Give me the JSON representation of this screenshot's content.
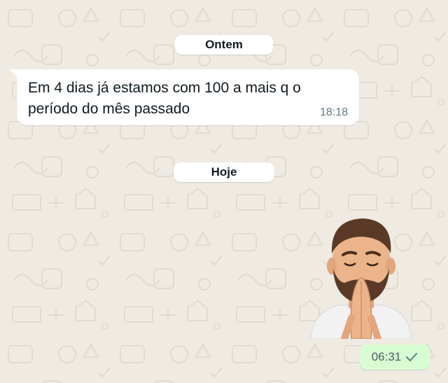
{
  "chat": {
    "date_yesterday": "Ontem",
    "date_today": "Hoje",
    "incoming_message": {
      "text": "Em 4 dias já estamos com 100 a mais q o período do mês passado",
      "time": "18:18"
    },
    "outgoing_sticker": {
      "icon": "praying-memoji-sticker",
      "time": "06:31",
      "status_icon": "single-check-icon"
    }
  },
  "colors": {
    "wallpaper": "#efeae2",
    "incoming_bubble": "#ffffff",
    "outgoing_bubble": "#d9fdd3"
  }
}
